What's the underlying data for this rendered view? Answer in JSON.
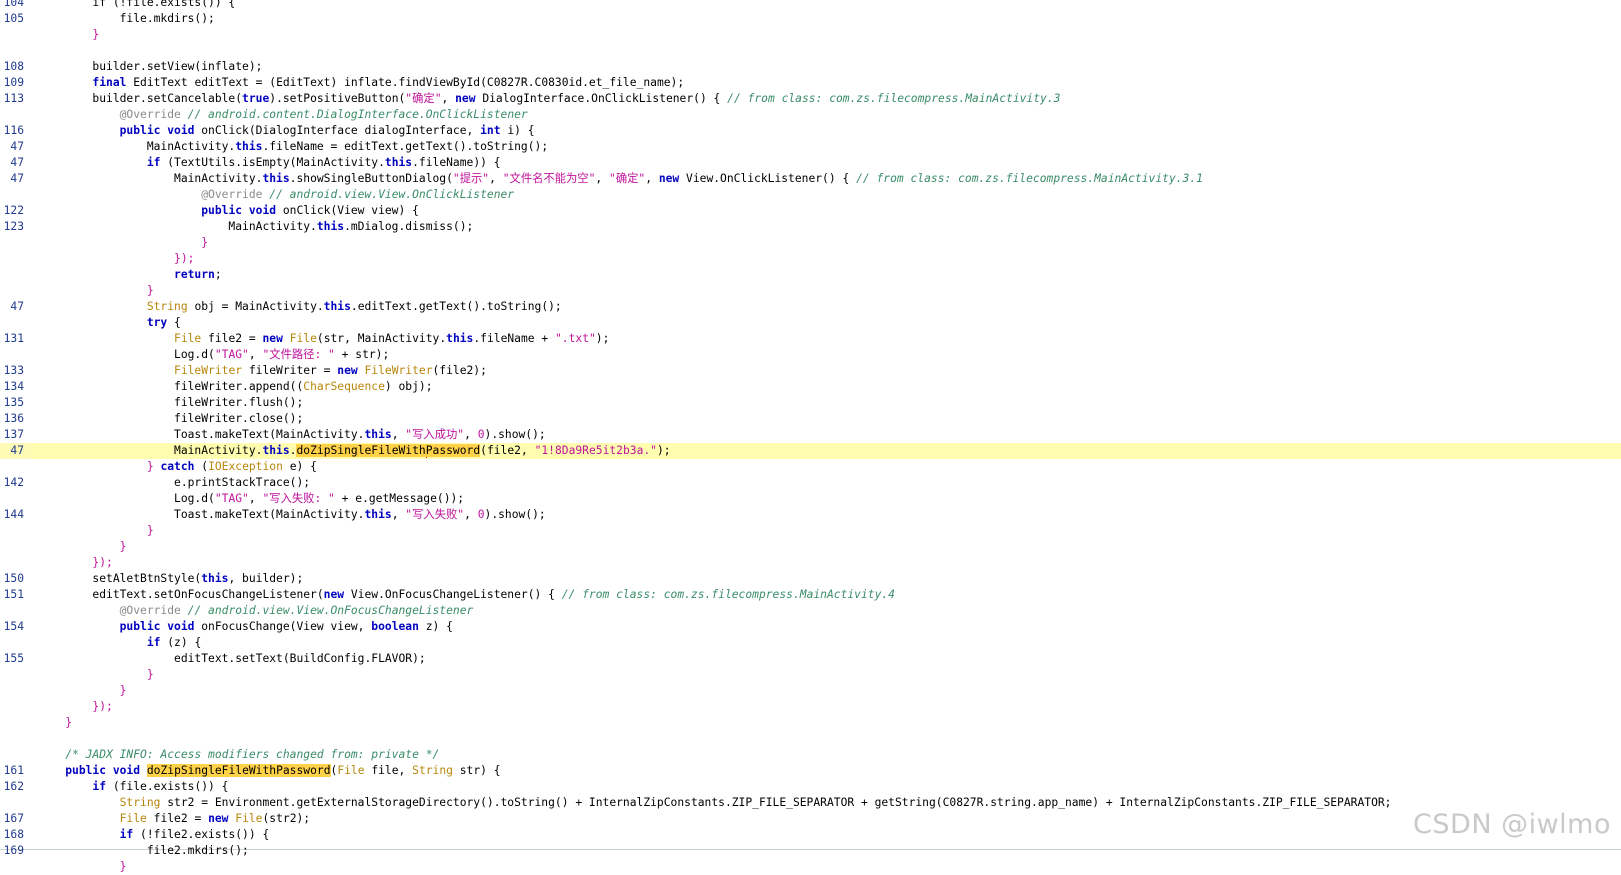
{
  "gutter": [
    "104",
    "105",
    "",
    "",
    "108",
    "109",
    "113",
    "",
    "116",
    "47",
    "47",
    "47",
    "",
    "122",
    "123",
    "",
    "",
    "",
    "",
    "47",
    "",
    "131",
    "",
    "133",
    "134",
    "135",
    "136",
    "137",
    "47",
    "",
    "142",
    "",
    "144",
    "",
    "",
    "",
    "150",
    "151",
    "",
    "154",
    "",
    "155",
    "",
    "",
    "",
    "",
    "",
    "",
    "161",
    "162",
    "",
    "167",
    "168",
    "169",
    ""
  ],
  "lines": [
    [
      {
        "t": "        if (!file.exists()) {",
        "c": "m"
      }
    ],
    [
      {
        "t": "            file.mkdirs();",
        "c": "m"
      }
    ],
    [
      {
        "t": "        }",
        "c": "p"
      }
    ],
    [
      {
        "t": "",
        "c": "m"
      }
    ],
    [
      {
        "t": "        builder.setView(inflate);",
        "c": "m"
      }
    ],
    [
      {
        "t": "        ",
        "c": "m"
      },
      {
        "t": "final",
        "c": "k"
      },
      {
        "t": " EditText editText = (EditText) inflate.findViewById(C0827R.C0830id.et_file_name);",
        "c": "m"
      }
    ],
    [
      {
        "t": "        builder.setCancelable(",
        "c": "m"
      },
      {
        "t": "true",
        "c": "k"
      },
      {
        "t": ").setPositiveButton(",
        "c": "m"
      },
      {
        "t": "\"确定\"",
        "c": "s"
      },
      {
        "t": ", ",
        "c": "m"
      },
      {
        "t": "new",
        "c": "k"
      },
      {
        "t": " DialogInterface.OnClickListener() { ",
        "c": "m"
      },
      {
        "t": "// from class: com.zs.filecompress.MainActivity.3",
        "c": "c"
      }
    ],
    [
      {
        "t": "            ",
        "c": "m"
      },
      {
        "t": "@Override",
        "c": "a"
      },
      {
        "t": " ",
        "c": "m"
      },
      {
        "t": "// android.content.DialogInterface.OnClickListener",
        "c": "c"
      }
    ],
    [
      {
        "t": "            ",
        "c": "m"
      },
      {
        "t": "public void",
        "c": "k"
      },
      {
        "t": " onClick(DialogInterface dialogInterface, ",
        "c": "m"
      },
      {
        "t": "int",
        "c": "k"
      },
      {
        "t": " i) {",
        "c": "m"
      }
    ],
    [
      {
        "t": "                MainActivity.",
        "c": "m"
      },
      {
        "t": "this",
        "c": "k"
      },
      {
        "t": ".fileName = editText.getText().toString();",
        "c": "m"
      }
    ],
    [
      {
        "t": "                ",
        "c": "m"
      },
      {
        "t": "if",
        "c": "k"
      },
      {
        "t": " (TextUtils.isEmpty(MainActivity.",
        "c": "m"
      },
      {
        "t": "this",
        "c": "k"
      },
      {
        "t": ".fileName)) {",
        "c": "m"
      }
    ],
    [
      {
        "t": "                    MainActivity.",
        "c": "m"
      },
      {
        "t": "this",
        "c": "k"
      },
      {
        "t": ".showSingleButtonDialog(",
        "c": "m"
      },
      {
        "t": "\"提示\"",
        "c": "s"
      },
      {
        "t": ", ",
        "c": "m"
      },
      {
        "t": "\"文件名不能为空\"",
        "c": "s"
      },
      {
        "t": ", ",
        "c": "m"
      },
      {
        "t": "\"确定\"",
        "c": "s"
      },
      {
        "t": ", ",
        "c": "m"
      },
      {
        "t": "new",
        "c": "k"
      },
      {
        "t": " View.OnClickListener() { ",
        "c": "m"
      },
      {
        "t": "// from class: com.zs.filecompress.MainActivity.3.1",
        "c": "c"
      }
    ],
    [
      {
        "t": "                        ",
        "c": "m"
      },
      {
        "t": "@Override",
        "c": "a"
      },
      {
        "t": " ",
        "c": "m"
      },
      {
        "t": "// android.view.View.OnClickListener",
        "c": "c"
      }
    ],
    [
      {
        "t": "                        ",
        "c": "m"
      },
      {
        "t": "public void",
        "c": "k"
      },
      {
        "t": " onClick(View view) {",
        "c": "m"
      }
    ],
    [
      {
        "t": "                            MainActivity.",
        "c": "m"
      },
      {
        "t": "this",
        "c": "k"
      },
      {
        "t": ".mDialog.dismiss();",
        "c": "m"
      }
    ],
    [
      {
        "t": "                        }",
        "c": "p"
      }
    ],
    [
      {
        "t": "                    });",
        "c": "p"
      }
    ],
    [
      {
        "t": "                    ",
        "c": "m"
      },
      {
        "t": "return",
        "c": "k"
      },
      {
        "t": ";",
        "c": "m"
      }
    ],
    [
      {
        "t": "                }",
        "c": "p"
      }
    ],
    [
      {
        "t": "                ",
        "c": "m"
      },
      {
        "t": "String",
        "c": "t"
      },
      {
        "t": " obj = MainActivity.",
        "c": "m"
      },
      {
        "t": "this",
        "c": "k"
      },
      {
        "t": ".editText.getText().toString();",
        "c": "m"
      }
    ],
    [
      {
        "t": "                ",
        "c": "m"
      },
      {
        "t": "try",
        "c": "k"
      },
      {
        "t": " {",
        "c": "m"
      }
    ],
    [
      {
        "t": "                    ",
        "c": "m"
      },
      {
        "t": "File",
        "c": "t"
      },
      {
        "t": " file2 = ",
        "c": "m"
      },
      {
        "t": "new",
        "c": "k"
      },
      {
        "t": " ",
        "c": "m"
      },
      {
        "t": "File",
        "c": "t"
      },
      {
        "t": "(str, MainActivity.",
        "c": "m"
      },
      {
        "t": "this",
        "c": "k"
      },
      {
        "t": ".fileName + ",
        "c": "m"
      },
      {
        "t": "\".txt\"",
        "c": "s"
      },
      {
        "t": ");",
        "c": "m"
      }
    ],
    [
      {
        "t": "                    Log.d(",
        "c": "m"
      },
      {
        "t": "\"TAG\"",
        "c": "s"
      },
      {
        "t": ", ",
        "c": "m"
      },
      {
        "t": "\"文件路径: \"",
        "c": "s"
      },
      {
        "t": " + str);",
        "c": "m"
      }
    ],
    [
      {
        "t": "                    ",
        "c": "m"
      },
      {
        "t": "FileWriter",
        "c": "t"
      },
      {
        "t": " fileWriter = ",
        "c": "m"
      },
      {
        "t": "new",
        "c": "k"
      },
      {
        "t": " ",
        "c": "m"
      },
      {
        "t": "FileWriter",
        "c": "t"
      },
      {
        "t": "(file2);",
        "c": "m"
      }
    ],
    [
      {
        "t": "                    fileWriter.append((",
        "c": "m"
      },
      {
        "t": "CharSequence",
        "c": "t"
      },
      {
        "t": ") obj);",
        "c": "m"
      }
    ],
    [
      {
        "t": "                    fileWriter.flush();",
        "c": "m"
      }
    ],
    [
      {
        "t": "                    fileWriter.close();",
        "c": "m"
      }
    ],
    [
      {
        "t": "                    Toast.makeText(MainActivity.",
        "c": "m"
      },
      {
        "t": "this",
        "c": "k"
      },
      {
        "t": ", ",
        "c": "m"
      },
      {
        "t": "\"写入成功\"",
        "c": "s"
      },
      {
        "t": ", ",
        "c": "m"
      },
      {
        "t": "0",
        "c": "s"
      },
      {
        "t": ").show();",
        "c": "m"
      }
    ],
    [
      {
        "t": "                    MainActivity.",
        "c": "m"
      },
      {
        "t": "this",
        "c": "k"
      },
      {
        "t": ".",
        "c": "m"
      },
      {
        "t": "doZipSingleFileWithPassword",
        "c": "f"
      },
      {
        "t": "(file2, ",
        "c": "m"
      },
      {
        "t": "\"1!8Da9Re5it2b3a.\"",
        "c": "s"
      },
      {
        "t": ");",
        "c": "m"
      }
    ],
    [
      {
        "t": "                } ",
        "c": "p"
      },
      {
        "t": "catch",
        "c": "k"
      },
      {
        "t": " (",
        "c": "m"
      },
      {
        "t": "IOException",
        "c": "t"
      },
      {
        "t": " e) {",
        "c": "m"
      }
    ],
    [
      {
        "t": "                    e.printStackTrace();",
        "c": "m"
      }
    ],
    [
      {
        "t": "                    Log.d(",
        "c": "m"
      },
      {
        "t": "\"TAG\"",
        "c": "s"
      },
      {
        "t": ", ",
        "c": "m"
      },
      {
        "t": "\"写入失败: \"",
        "c": "s"
      },
      {
        "t": " + e.getMessage());",
        "c": "m"
      }
    ],
    [
      {
        "t": "                    Toast.makeText(MainActivity.",
        "c": "m"
      },
      {
        "t": "this",
        "c": "k"
      },
      {
        "t": ", ",
        "c": "m"
      },
      {
        "t": "\"写入失败\"",
        "c": "s"
      },
      {
        "t": ", ",
        "c": "m"
      },
      {
        "t": "0",
        "c": "s"
      },
      {
        "t": ").show();",
        "c": "m"
      }
    ],
    [
      {
        "t": "                }",
        "c": "p"
      }
    ],
    [
      {
        "t": "            }",
        "c": "p"
      }
    ],
    [
      {
        "t": "        });",
        "c": "p"
      }
    ],
    [
      {
        "t": "        setAletBtnStyle(",
        "c": "m"
      },
      {
        "t": "this",
        "c": "k"
      },
      {
        "t": ", builder);",
        "c": "m"
      }
    ],
    [
      {
        "t": "        editText.setOnFocusChangeListener(",
        "c": "m"
      },
      {
        "t": "new",
        "c": "k"
      },
      {
        "t": " View.OnFocusChangeListener() { ",
        "c": "m"
      },
      {
        "t": "// from class: com.zs.filecompress.MainActivity.4",
        "c": "c"
      }
    ],
    [
      {
        "t": "            ",
        "c": "m"
      },
      {
        "t": "@Override",
        "c": "a"
      },
      {
        "t": " ",
        "c": "m"
      },
      {
        "t": "// android.view.View.OnFocusChangeListener",
        "c": "c"
      }
    ],
    [
      {
        "t": "            ",
        "c": "m"
      },
      {
        "t": "public void",
        "c": "k"
      },
      {
        "t": " onFocusChange(View view, ",
        "c": "m"
      },
      {
        "t": "boolean",
        "c": "k"
      },
      {
        "t": " z) {",
        "c": "m"
      }
    ],
    [
      {
        "t": "                ",
        "c": "m"
      },
      {
        "t": "if",
        "c": "k"
      },
      {
        "t": " (z) {",
        "c": "m"
      }
    ],
    [
      {
        "t": "                    editText.setText(BuildConfig.FLAVOR);",
        "c": "m"
      }
    ],
    [
      {
        "t": "                }",
        "c": "p"
      }
    ],
    [
      {
        "t": "            }",
        "c": "p"
      }
    ],
    [
      {
        "t": "        });",
        "c": "p"
      }
    ],
    [
      {
        "t": "    }",
        "c": "p"
      }
    ],
    [
      {
        "t": "",
        "c": "m"
      }
    ],
    [
      {
        "t": "    ",
        "c": "m"
      },
      {
        "t": "/* JADX INFO: Access modifiers changed from: private */",
        "c": "c"
      }
    ],
    [
      {
        "t": "    ",
        "c": "m"
      },
      {
        "t": "public void",
        "c": "k"
      },
      {
        "t": " ",
        "c": "m"
      },
      {
        "t": "doZipSingleFileWithPassword",
        "c": "f"
      },
      {
        "t": "(",
        "c": "m"
      },
      {
        "t": "File",
        "c": "t"
      },
      {
        "t": " file, ",
        "c": "m"
      },
      {
        "t": "String",
        "c": "t"
      },
      {
        "t": " str) {",
        "c": "m"
      }
    ],
    [
      {
        "t": "        ",
        "c": "m"
      },
      {
        "t": "if",
        "c": "k"
      },
      {
        "t": " (file.exists()) {",
        "c": "m"
      }
    ],
    [
      {
        "t": "            ",
        "c": "m"
      },
      {
        "t": "String",
        "c": "t"
      },
      {
        "t": " str2 = Environment.getExternalStorageDirectory().toString() + InternalZipConstants.ZIP_FILE_SEPARATOR + getString(C0827R.string.app_name) + InternalZipConstants.ZIP_FILE_SEPARATOR;",
        "c": "m"
      }
    ],
    [
      {
        "t": "            ",
        "c": "m"
      },
      {
        "t": "File",
        "c": "t"
      },
      {
        "t": " file2 = ",
        "c": "m"
      },
      {
        "t": "new",
        "c": "k"
      },
      {
        "t": " ",
        "c": "m"
      },
      {
        "t": "File",
        "c": "t"
      },
      {
        "t": "(str2);",
        "c": "m"
      }
    ],
    [
      {
        "t": "            ",
        "c": "m"
      },
      {
        "t": "if",
        "c": "k"
      },
      {
        "t": " (!file2.exists()) {",
        "c": "m"
      }
    ],
    [
      {
        "t": "                file2.mkdirs();",
        "c": "m"
      }
    ],
    [
      {
        "t": "            }",
        "c": "p"
      }
    ]
  ],
  "highlight_line": 28,
  "watermark": "CSDN @iwlmo"
}
